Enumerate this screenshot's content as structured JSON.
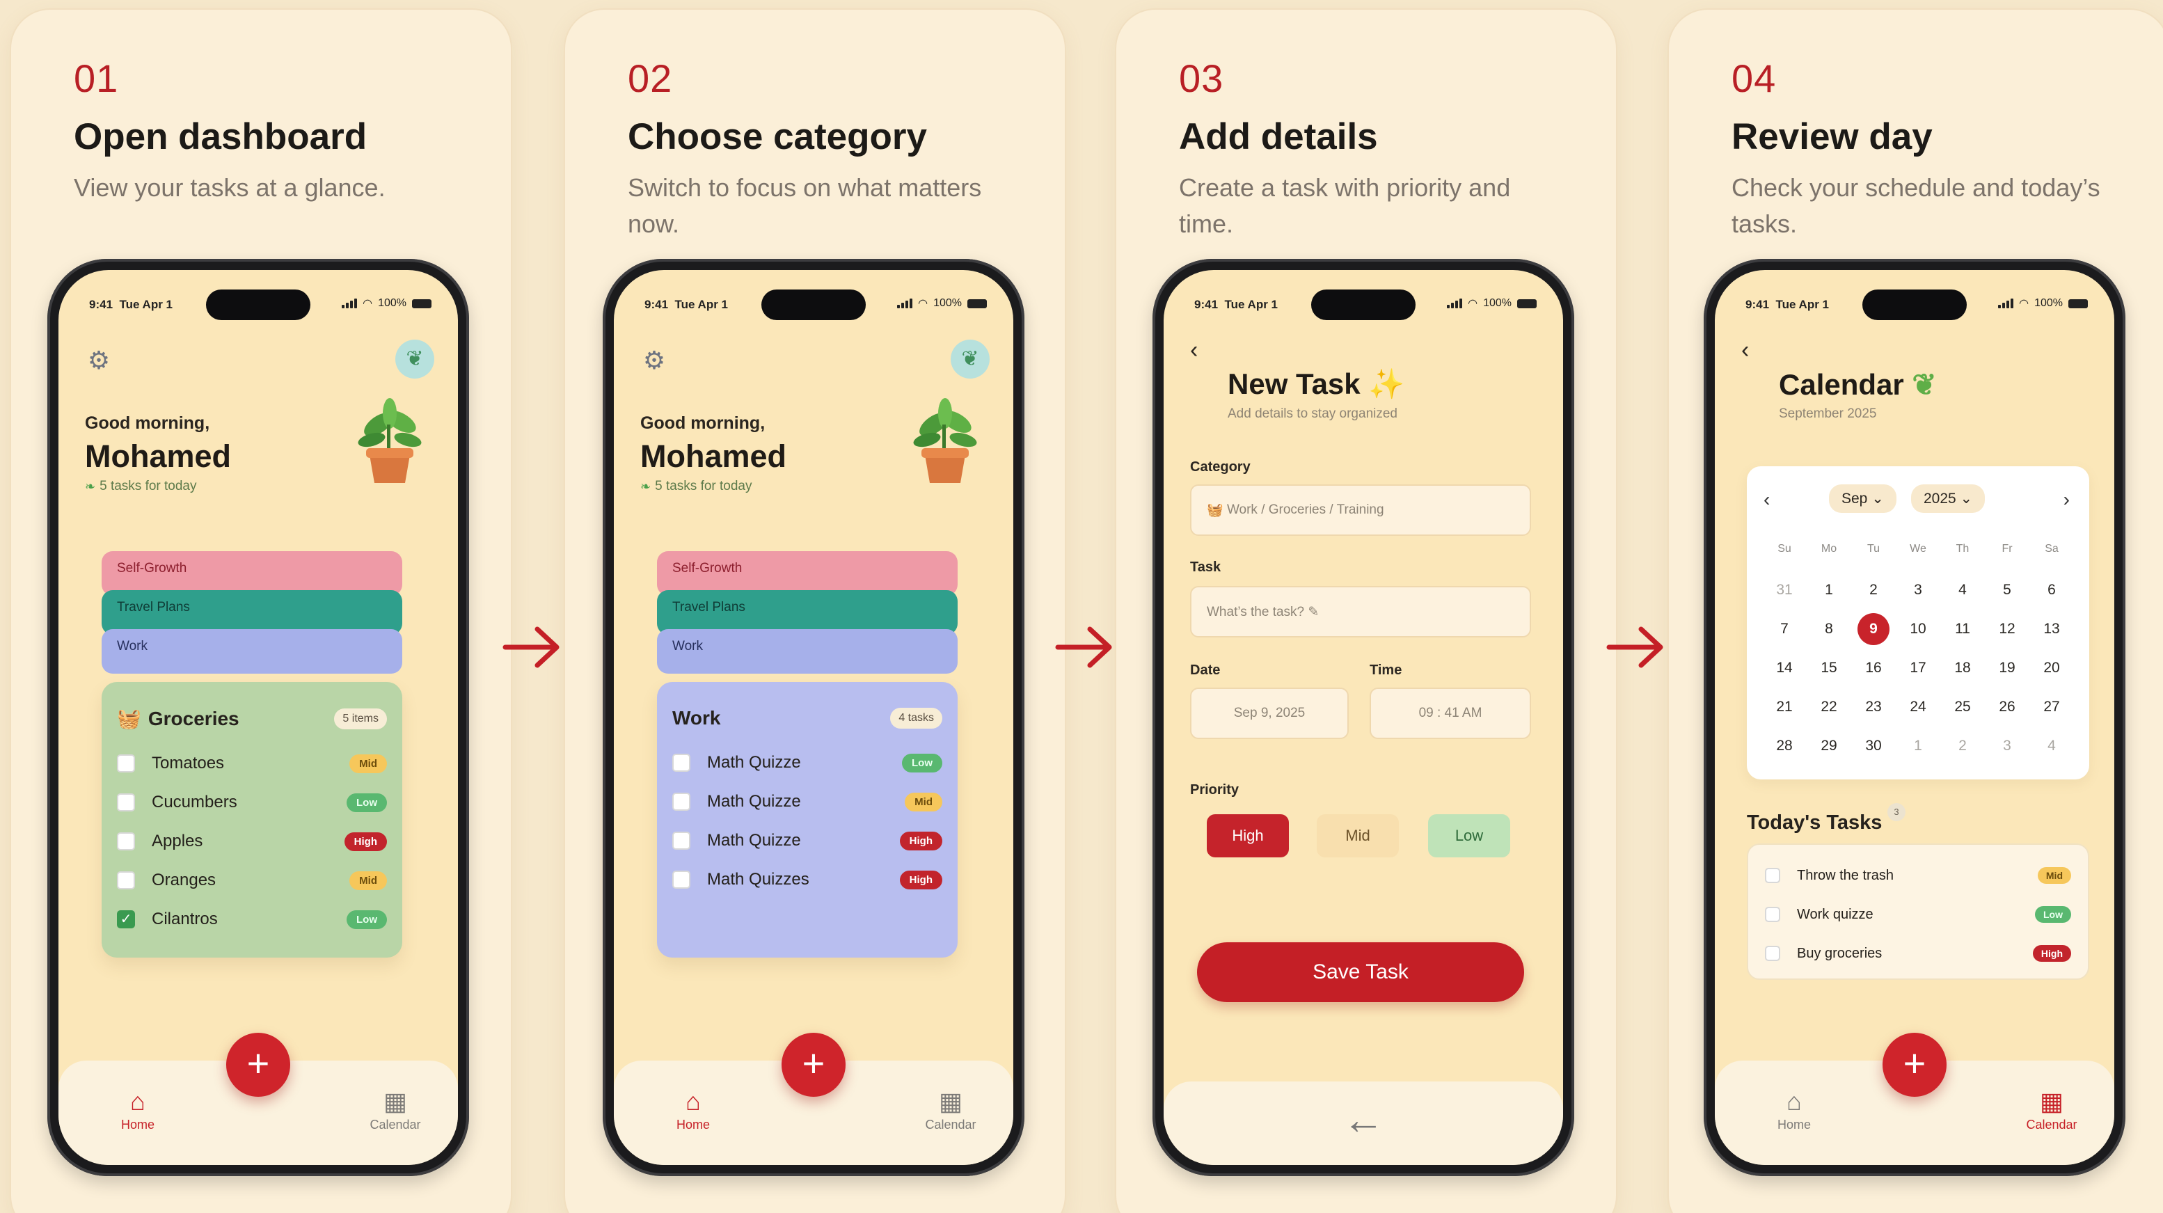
{
  "cards": [
    {
      "step": "01",
      "title": "Open dashboard",
      "desc": "View your tasks at a glance."
    },
    {
      "step": "02",
      "title": "Choose category",
      "desc": "Switch to focus on what matters now."
    },
    {
      "step": "03",
      "title": "Add details",
      "desc": "Create a task with priority and time."
    },
    {
      "step": "04",
      "title": "Review day",
      "desc": "Check your schedule and today’s tasks."
    }
  ],
  "status": {
    "time": "9:41",
    "date": "Tue Apr 1",
    "battery": "100%"
  },
  "dashboard": {
    "greeting": "Good morning,",
    "name": "Mohamed",
    "subtitle": "5 tasks for today",
    "tabs": [
      "Self-Growth",
      "Travel Plans",
      "Work"
    ]
  },
  "groceries": {
    "title": "Groceries",
    "count": "5 items",
    "items": [
      {
        "label": "Tomatoes",
        "priority": "Mid",
        "done": false
      },
      {
        "label": "Cucumbers",
        "priority": "Low",
        "done": false
      },
      {
        "label": "Apples",
        "priority": "High",
        "done": false
      },
      {
        "label": "Oranges",
        "priority": "Mid",
        "done": false
      },
      {
        "label": "Cilantros",
        "priority": "Low",
        "done": true
      }
    ]
  },
  "work": {
    "tabs": [
      "Self-Growth",
      "Travel Plans"
    ],
    "title": "Work",
    "count": "4 tasks",
    "items": [
      {
        "label": "Math Quizze",
        "priority": "Low"
      },
      {
        "label": "Math Quizze",
        "priority": "Mid"
      },
      {
        "label": "Math Quizze",
        "priority": "High"
      },
      {
        "label": "Math Quizzes",
        "priority": "High"
      }
    ]
  },
  "nav": {
    "home": "Home",
    "calendar": "Calendar"
  },
  "new_task": {
    "back": "‹",
    "title": "New Task ✨",
    "subtitle": "Add details to stay organized",
    "category_label": "Category",
    "category_value": "Work / Groceries / Training",
    "task_label": "Task",
    "task_placeholder": "What’s the task? ✎",
    "date_label": "Date",
    "date_value": "Sep 9, 2025",
    "time_label": "Time",
    "time_value": "09 : 41 AM",
    "priority_label": "Priority",
    "priorities": [
      "High",
      "Mid",
      "Low"
    ],
    "save": "Save Task",
    "bottom_back": "←"
  },
  "calendar": {
    "title": "Calendar",
    "subtitle": "September 2025",
    "month": "Sep ⌄",
    "year": "2025 ⌄",
    "weekdays": [
      "Su",
      "Mo",
      "Tu",
      "We",
      "Th",
      "Fr",
      "Sa"
    ],
    "days": [
      [
        "31",
        "1",
        "2",
        "3",
        "4",
        "5",
        "6"
      ],
      [
        "7",
        "8",
        "9",
        "10",
        "11",
        "12",
        "13"
      ],
      [
        "14",
        "15",
        "16",
        "17",
        "18",
        "19",
        "20"
      ],
      [
        "21",
        "22",
        "23",
        "24",
        "25",
        "26",
        "27"
      ],
      [
        "28",
        "29",
        "30",
        "1",
        "2",
        "3",
        "4"
      ]
    ],
    "selected_day": "9",
    "today_title": "Today's Tasks",
    "today_count": "3",
    "today_tasks": [
      {
        "label": "Throw the trash",
        "priority": "Mid"
      },
      {
        "label": "Work quizze",
        "priority": "Low"
      },
      {
        "label": "Buy groceries",
        "priority": "High"
      }
    ]
  },
  "colors": {
    "accent": "#c41f26",
    "background": "#f6e8cc",
    "screen": "#fbe7b9"
  },
  "icons": [
    "gear-icon",
    "sprout-icon",
    "home-icon",
    "calendar-icon",
    "plus-icon",
    "arrow-right-icon",
    "sparkles-icon",
    "leaf-icon",
    "basket-icon"
  ]
}
